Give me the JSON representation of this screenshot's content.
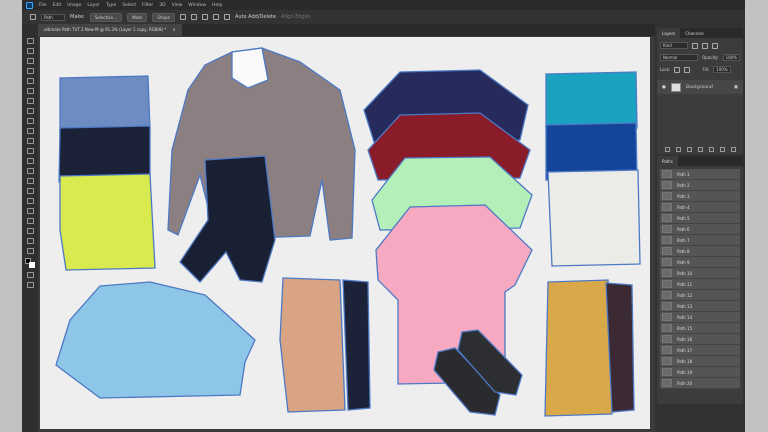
{
  "menu": [
    "File",
    "Edit",
    "Image",
    "Layer",
    "Type",
    "Select",
    "Filter",
    "3D",
    "View",
    "Window",
    "Help"
  ],
  "options": {
    "path_mode": "Path",
    "make_label": "Make:",
    "selection": "Selection...",
    "mask": "Mask",
    "shape": "Shape",
    "auto_add": "Auto Add/Delete",
    "align_edges": "Align Edges"
  },
  "document_tab": {
    "title": "ultimate Path TUT 2 New-M @ 91.3% (Layer 1 copy, RGB/8) *",
    "close": "×"
  },
  "layers_panel": {
    "tabs": [
      "Layers",
      "Channels"
    ],
    "kind": "Kind",
    "blend": "Normal",
    "opacity_label": "Opacity:",
    "opacity": "100%",
    "lock_label": "Lock:",
    "fill_label": "Fill:",
    "fill": "100%",
    "layers": [
      {
        "name": "Background",
        "visible": true,
        "locked": true
      }
    ]
  },
  "paths_panel": {
    "title": "Paths",
    "paths": [
      "Path 1",
      "Path 2",
      "Path 3",
      "Path 4",
      "Path 5",
      "Path 6",
      "Path 7",
      "Path 8",
      "Path 9",
      "Path 10",
      "Path 11",
      "Path 12",
      "Path 13",
      "Path 14",
      "Path 15",
      "Path 16",
      "Path 17",
      "Path 18",
      "Path 19",
      "Path 20"
    ]
  },
  "colors": {
    "path_outline": "#4d79c4",
    "ps_dark": "#3a3a3a",
    "canvas_bg": "#eeeeef"
  }
}
